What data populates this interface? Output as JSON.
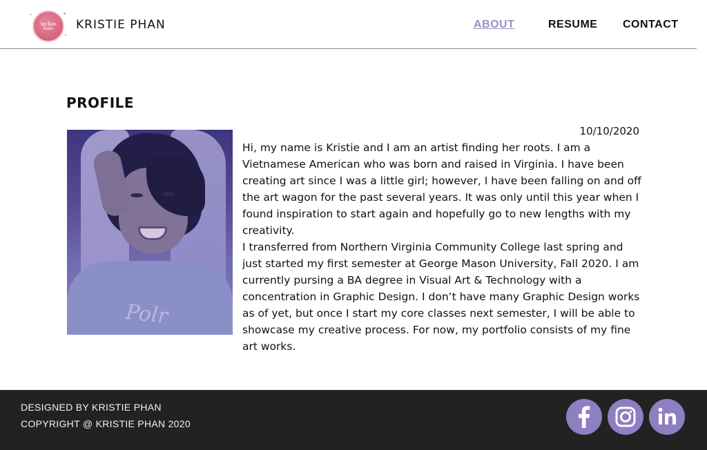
{
  "header": {
    "logo": {
      "line1": "kp-han",
      "line2": "studio",
      "color": "#d9687f"
    },
    "brand": "KRISTIE PHAN",
    "nav": [
      {
        "label": "ABOUT",
        "active": true,
        "color": "#9a8fc0"
      },
      {
        "label": "RESUME",
        "active": false
      },
      {
        "label": "CONTACT",
        "active": false
      }
    ]
  },
  "main": {
    "title": "PROFILE",
    "date": "10/10/2020",
    "photo_text": "Polr",
    "paragraphs": [
      "Hi, my name is Kristie and I am an artist finding her roots. I am a Vietnamese American who was born and raised in Virginia. I have been creating art since I was a little girl; however, I have been falling on and off the art wagon for the past several years. It was only until this year when I found inspiration to start again and hopefully go to new lengths with my creativity.",
      "I transferred from Northern Virginia Community College last spring and just started my first semester at George Mason University, Fall 2020. I am currently pursing a BA degree in Visual Art & Technology with a concentration in Graphic Design.  I don’t have many Graphic Design works as of yet, but once I start my core classes next semester, I will be able to showcase my creative process. For now, my portfolio consists of my fine art works."
    ]
  },
  "footer": {
    "line1": "DESIGNED BY KRISTIE PHAN",
    "line2": "COPYRIGHT @ KRISTIE PHAN 2020",
    "social": [
      {
        "icon": "facebook-icon"
      },
      {
        "icon": "instagram-icon"
      },
      {
        "icon": "linkedin-icon"
      }
    ],
    "social_color": "#8d7fc0",
    "background": "#222222"
  }
}
